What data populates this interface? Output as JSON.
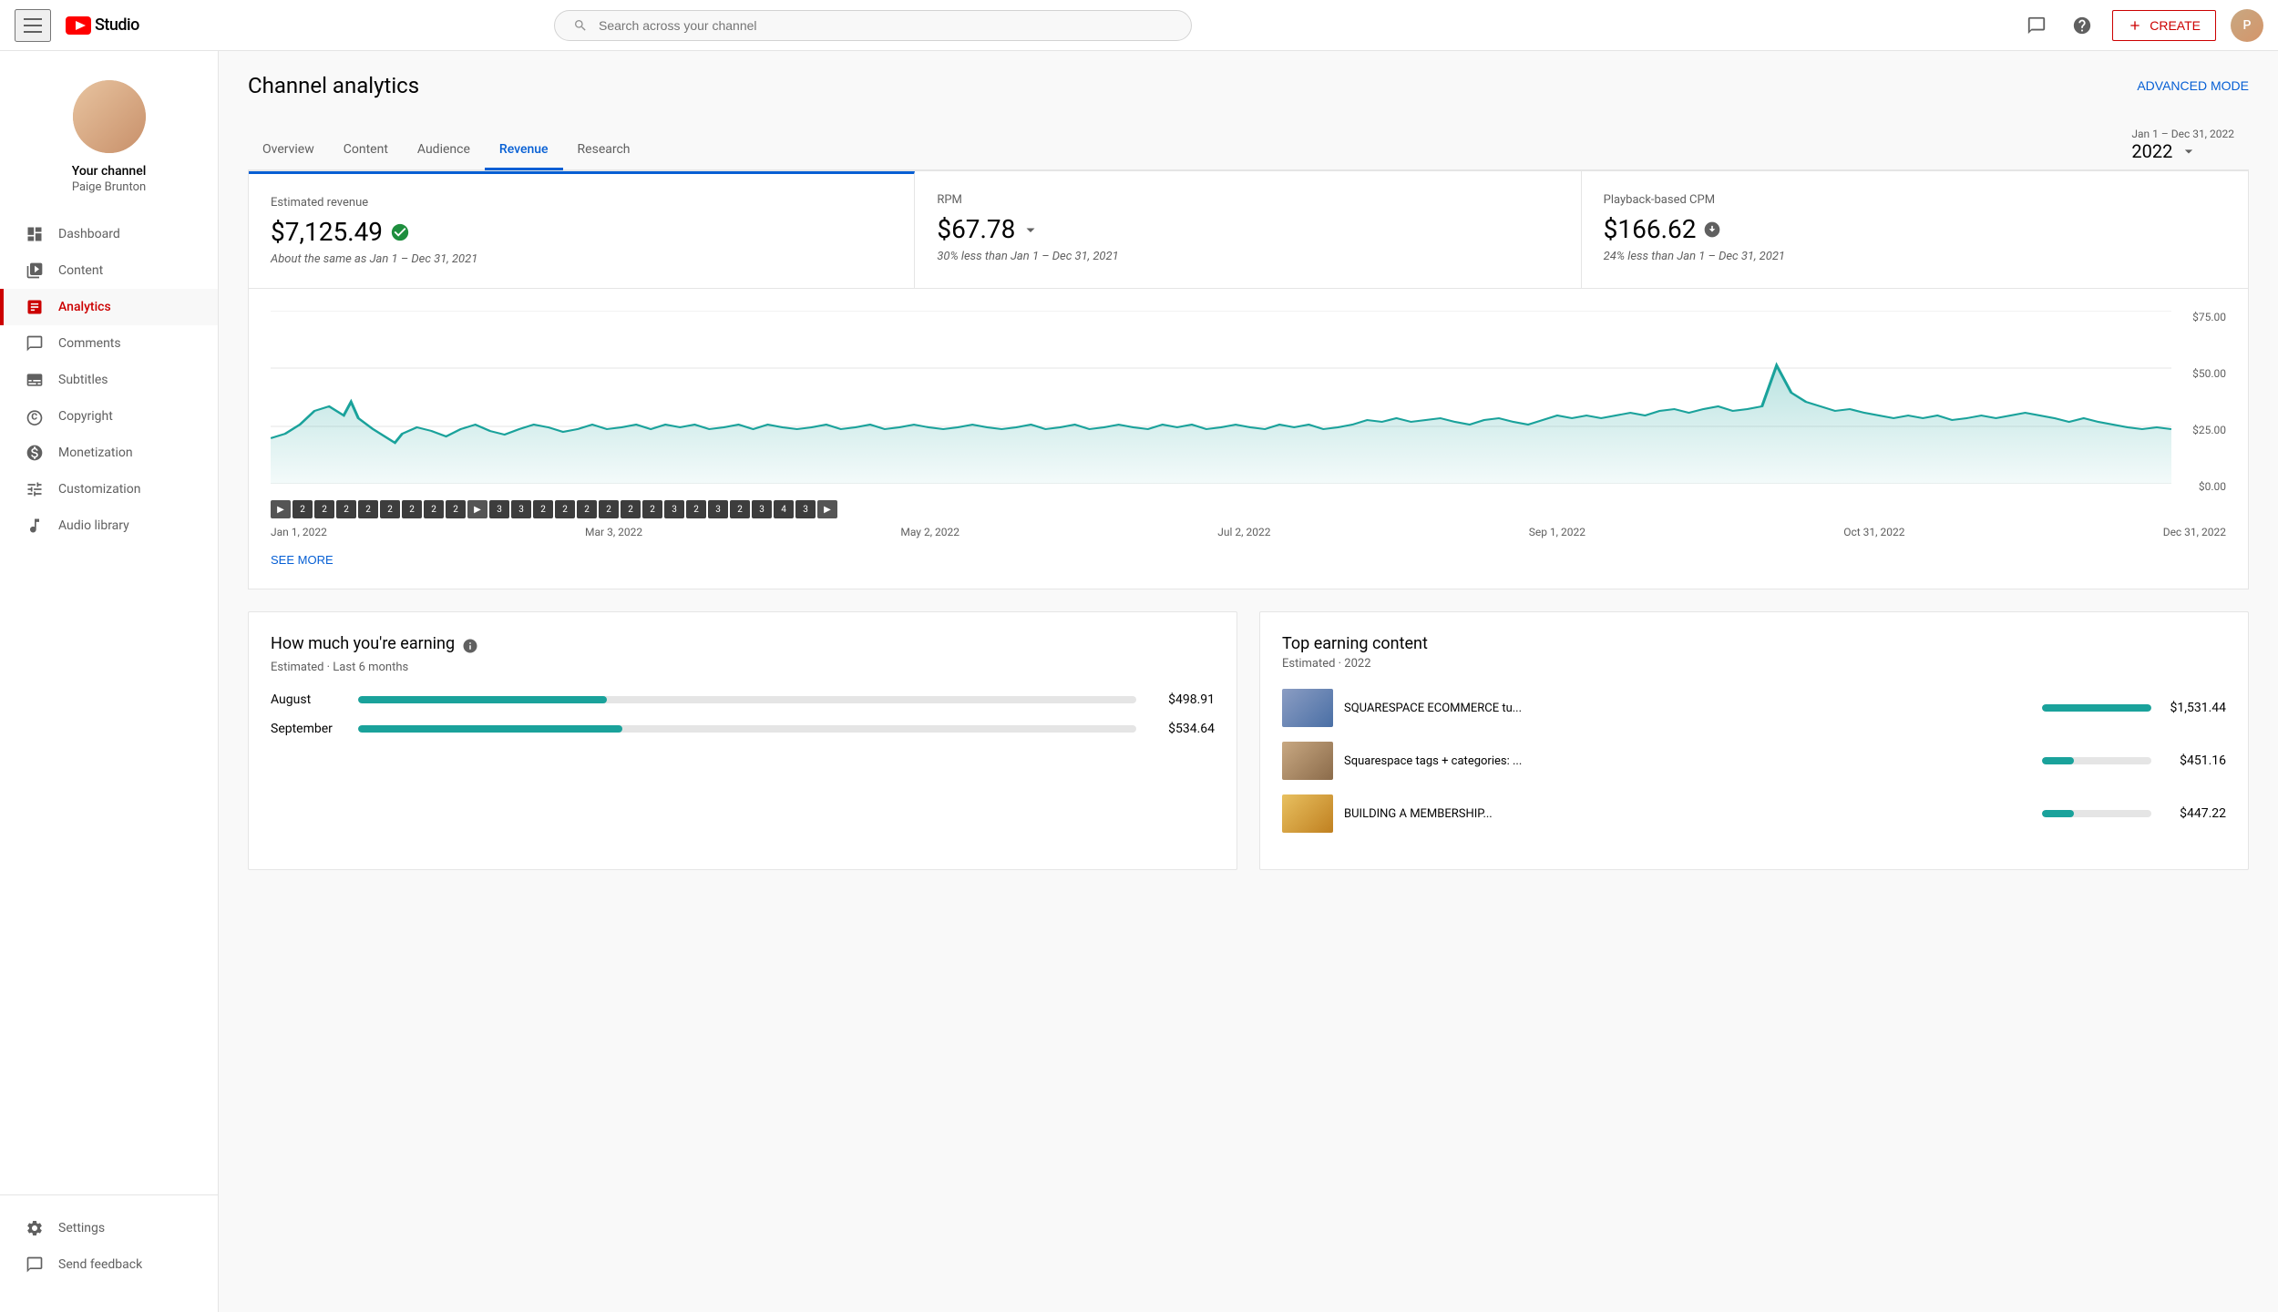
{
  "app": {
    "title": "YouTube Studio",
    "search_placeholder": "Search across your channel"
  },
  "topnav": {
    "create_label": "CREATE",
    "messages_icon": "messages",
    "help_icon": "help"
  },
  "sidebar": {
    "channel_name": "Your channel",
    "channel_handle": "Paige Brunton",
    "nav_items": [
      {
        "id": "dashboard",
        "label": "Dashboard",
        "icon": "dashboard"
      },
      {
        "id": "content",
        "label": "Content",
        "icon": "content"
      },
      {
        "id": "analytics",
        "label": "Analytics",
        "icon": "analytics",
        "active": true
      },
      {
        "id": "comments",
        "label": "Comments",
        "icon": "comments"
      },
      {
        "id": "subtitles",
        "label": "Subtitles",
        "icon": "subtitles"
      },
      {
        "id": "copyright",
        "label": "Copyright",
        "icon": "copyright"
      },
      {
        "id": "monetization",
        "label": "Monetization",
        "icon": "monetization"
      },
      {
        "id": "customization",
        "label": "Customization",
        "icon": "customization"
      },
      {
        "id": "audio_library",
        "label": "Audio library",
        "icon": "audio"
      }
    ],
    "footer_items": [
      {
        "id": "settings",
        "label": "Settings",
        "icon": "settings"
      },
      {
        "id": "feedback",
        "label": "Send feedback",
        "icon": "feedback"
      }
    ]
  },
  "analytics": {
    "page_title": "Channel analytics",
    "advanced_mode": "ADVANCED MODE",
    "date_range": "Jan 1 – Dec 31, 2022",
    "date_year": "2022",
    "tabs": [
      {
        "id": "overview",
        "label": "Overview",
        "active": false
      },
      {
        "id": "content",
        "label": "Content",
        "active": false
      },
      {
        "id": "audience",
        "label": "Audience",
        "active": false
      },
      {
        "id": "revenue",
        "label": "Revenue",
        "active": true
      },
      {
        "id": "research",
        "label": "Research",
        "active": false
      }
    ],
    "metrics": [
      {
        "label": "Estimated revenue",
        "value": "$7,125.49",
        "status": "same",
        "change": "About the same as Jan 1 – Dec 31, 2021",
        "active": true
      },
      {
        "label": "RPM",
        "value": "$67.78",
        "status": "down",
        "change": "30% less than Jan 1 – Dec 31, 2021",
        "active": false
      },
      {
        "label": "Playback-based CPM",
        "value": "$166.62",
        "status": "down",
        "change": "24% less than Jan 1 – Dec 31, 2021",
        "active": false
      }
    ],
    "chart": {
      "y_labels": [
        "$75.00",
        "$50.00",
        "$25.00",
        "$0.00"
      ],
      "date_labels": [
        "Jan 1, 2022",
        "Mar 3, 2022",
        "May 2, 2022",
        "Jul 2, 2022",
        "Sep 1, 2022",
        "Oct 31, 2022",
        "Dec 31, 2022"
      ],
      "see_more": "SEE MORE"
    },
    "earnings": {
      "title": "How much you're earning",
      "subtitle": "Estimated · Last 6 months",
      "icon": "info",
      "rows": [
        {
          "month": "August",
          "amount": "$498.91",
          "pct": 32
        },
        {
          "month": "September",
          "amount": "$534.64",
          "pct": 34
        }
      ]
    },
    "top_content": {
      "title": "Top earning content",
      "subtitle": "Estimated · 2022",
      "items": [
        {
          "title": "SQUARESPACE ECOMMERCE tu...",
          "amount": "$1,531.44",
          "pct": 100
        },
        {
          "title": "Squarespace tags + categories: ...",
          "amount": "$451.16",
          "pct": 29
        },
        {
          "title": "BUILDING A MEMBERSHIP...",
          "amount": "$447.22",
          "pct": 29
        }
      ]
    }
  }
}
